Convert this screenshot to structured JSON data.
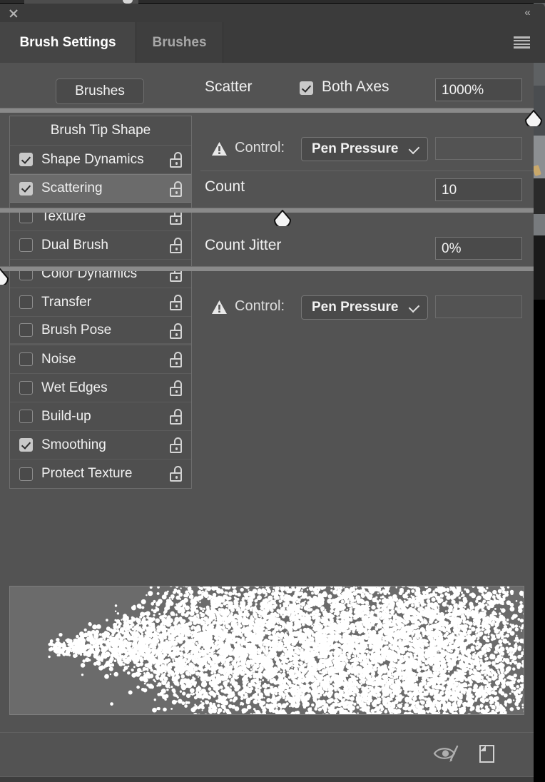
{
  "window": {
    "close_icon": "close-icon",
    "collapse_label": "«"
  },
  "tabs": [
    {
      "label": "Brush Settings",
      "active": true
    },
    {
      "label": "Brushes",
      "active": false
    }
  ],
  "menu_icon": "hamburger-menu-icon",
  "brushes_button": {
    "label": "Brushes"
  },
  "options_list": {
    "header": "Brush Tip Shape",
    "items": [
      {
        "label": "Shape Dynamics",
        "checked": true,
        "selected": false,
        "lock": "unlocked-icon"
      },
      {
        "label": "Scattering",
        "checked": true,
        "selected": true,
        "lock": "unlocked-icon"
      },
      {
        "label": "Texture",
        "checked": false,
        "selected": false,
        "lock": "unlocked-icon"
      },
      {
        "label": "Dual Brush",
        "checked": false,
        "selected": false,
        "lock": "unlocked-icon"
      },
      {
        "label": "Color Dynamics",
        "checked": false,
        "selected": false,
        "lock": "unlocked-icon"
      },
      {
        "label": "Transfer",
        "checked": false,
        "selected": false,
        "lock": "unlocked-icon"
      },
      {
        "label": "Brush Pose",
        "checked": false,
        "selected": false,
        "lock": "unlocked-icon"
      },
      {
        "label": "Noise",
        "checked": false,
        "selected": false,
        "lock": "unlocked-icon"
      },
      {
        "label": "Wet Edges",
        "checked": false,
        "selected": false,
        "lock": "unlocked-icon"
      },
      {
        "label": "Build-up",
        "checked": false,
        "selected": false,
        "lock": "unlocked-icon"
      },
      {
        "label": "Smoothing",
        "checked": true,
        "selected": false,
        "lock": "unlocked-icon"
      },
      {
        "label": "Protect Texture",
        "checked": false,
        "selected": false,
        "lock": "unlocked-icon"
      }
    ]
  },
  "settings": {
    "scatter": {
      "label": "Scatter",
      "both_axes_label": "Both Axes",
      "both_axes_checked": true,
      "value": "1000%",
      "slider_percent": 100,
      "control_label": "Control:",
      "control_value": "Pen Pressure",
      "warning_icon": "warning-icon"
    },
    "count": {
      "label": "Count",
      "value": "10",
      "slider_percent": 53
    },
    "count_jitter": {
      "label": "Count Jitter",
      "value": "0%",
      "slider_percent": 0,
      "control_label": "Control:",
      "control_value": "Pen Pressure",
      "warning_icon": "warning-icon"
    }
  },
  "footer": {
    "toggle_brush_preview_icon": "eye-brush-icon",
    "new_brush_icon": "new-brush-icon"
  },
  "colors": {
    "panel_bg": "#535353",
    "tab_active_bg": "#454545",
    "list_bg": "#4f4f4f",
    "selected_row": "#6b6b6b",
    "text": "#f0f0f0",
    "preview_bg": "#6b6b6b"
  }
}
